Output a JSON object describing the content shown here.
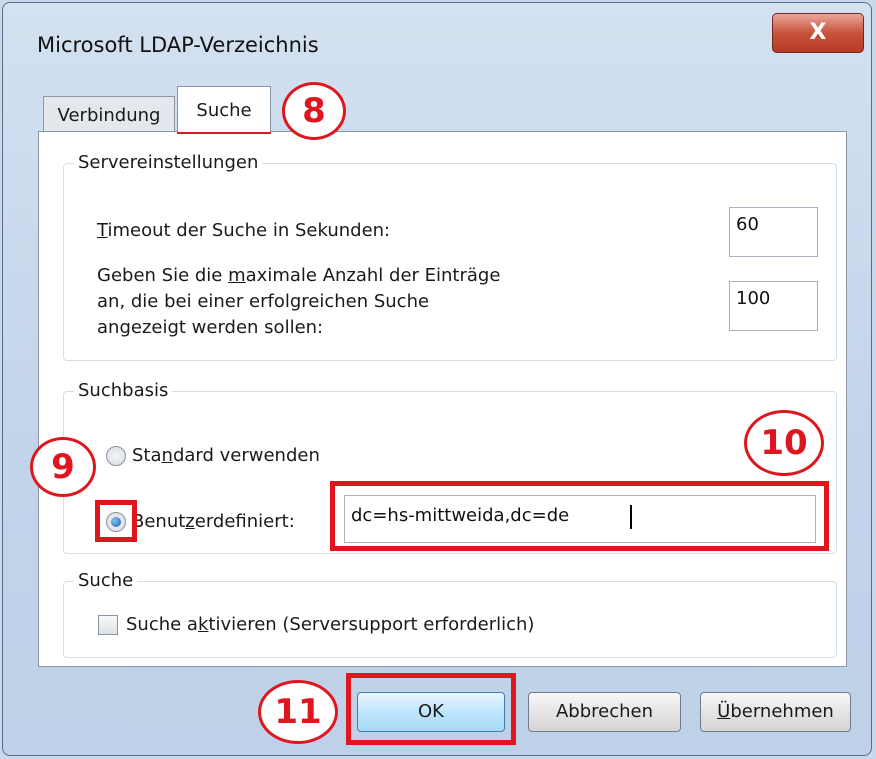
{
  "window": {
    "title": "Microsoft LDAP-Verzeichnis",
    "close_label": "X"
  },
  "tabs": [
    {
      "label": "Verbindung"
    },
    {
      "label": "Suche"
    }
  ],
  "server_settings": {
    "group_label": "Servereinstellungen",
    "timeout_label_u": "T",
    "timeout_label_rest": "imeout der Suche in Sekunden:",
    "timeout_value": "60",
    "max_label_line1_pre": "Geben Sie die ",
    "max_label_line1_u": "m",
    "max_label_line1_post": "aximale Anzahl der Einträge",
    "max_label_line2": "an, die bei einer erfolgreichen Suche",
    "max_label_line3": "angezeigt werden sollen:",
    "max_value": "100"
  },
  "search_base": {
    "group_label": "Suchbasis",
    "standard_pre": "Sta",
    "standard_u": "n",
    "standard_post": "dard verwenden",
    "custom_pre": "Benut",
    "custom_u": "z",
    "custom_post": "erdefiniert:",
    "custom_value": "dc=hs-mittweida,dc=de"
  },
  "search": {
    "group_label": "Suche",
    "checkbox_pre": "Suche a",
    "checkbox_u": "k",
    "checkbox_post": "tivieren (Serversupport erforderlich)"
  },
  "buttons": {
    "ok": "OK",
    "cancel": "Abbrechen",
    "apply_u": "Ü",
    "apply_rest": "bernehmen"
  },
  "annotations": [
    "8",
    "9",
    "10",
    "11"
  ],
  "colors": {
    "annotation_red": "#e0161f",
    "default_button": "#bee6fd"
  }
}
